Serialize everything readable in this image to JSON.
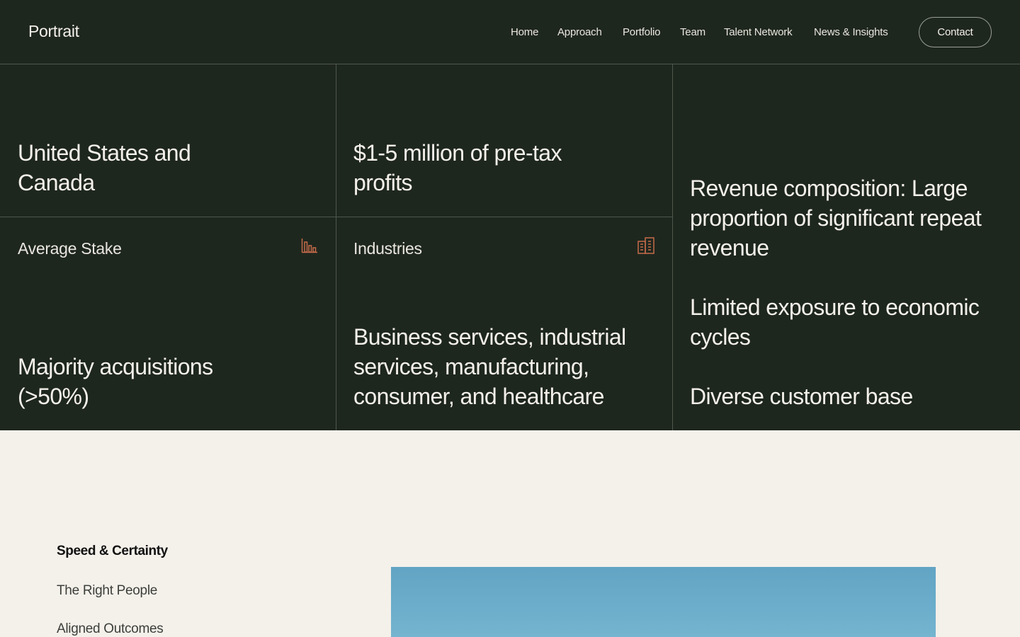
{
  "header": {
    "logo": "Portrait",
    "nav": [
      "Home",
      "Approach",
      "Portfolio",
      "Team",
      "Talent Network",
      "News & Insights"
    ],
    "contact_label": "Contact"
  },
  "criteria": {
    "geography": "United States and Canada",
    "profits": "$1-5 million of pre-tax profits",
    "stake": {
      "label": "Average Stake",
      "value": "Majority acquisitions (>50%)",
      "icon": "bar-chart-icon"
    },
    "industries": {
      "label": "Industries",
      "value": "Business services, industrial services, manufacturing, consumer, and healthcare",
      "icon": "building-icon"
    },
    "characteristics": [
      "Revenue composition: Large proportion of significant repeat revenue",
      "Limited exposure to economic cycles",
      "Diverse customer base"
    ]
  },
  "section_nav": [
    {
      "label": "Speed & Certainty",
      "active": true
    },
    {
      "label": "The Right People",
      "active": false
    },
    {
      "label": "Aligned Outcomes",
      "active": false
    }
  ],
  "colors": {
    "dark_bg": "#1e271e",
    "light_bg": "#f4f0ea",
    "accent_icon": "#c66b4a"
  }
}
